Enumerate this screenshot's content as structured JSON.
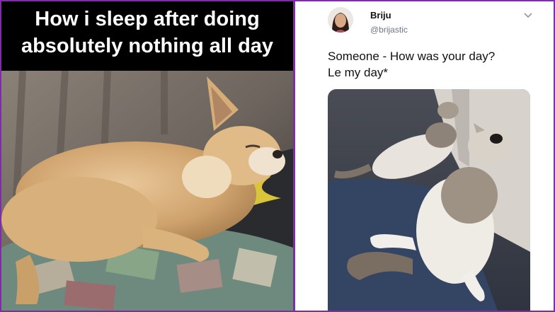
{
  "meme_left": {
    "caption_line1": "How i sleep after doing",
    "caption_line2": "absolutely nothing all day"
  },
  "tweet": {
    "display_name": "Briju",
    "handle": "@brijastic",
    "text_line1": "Someone - How was your day?",
    "text_line2": "Le my day*",
    "menu_icon": "chevron-down-icon"
  },
  "colors": {
    "frame": "#7b2fa0",
    "caption_bg": "#000000",
    "caption_text": "#ffffff"
  }
}
